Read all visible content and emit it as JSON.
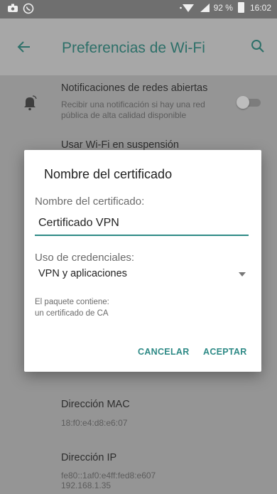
{
  "status_bar": {
    "battery": "92 %",
    "time": "16:02"
  },
  "app_bar": {
    "title": "Preferencias de Wi-Fi"
  },
  "settings": {
    "open_networks_title": "Notificaciones de redes abiertas",
    "open_networks_desc_line1": "Recibir una notificación si hay una red",
    "open_networks_desc_line2": "pública de alta calidad disponible",
    "sleep_title": "Usar Wi-Fi en suspensión",
    "mac_title": "Dirección MAC",
    "mac_value": "18:f0:e4:d8:e6:07",
    "ip_title": "Dirección IP",
    "ip_value_line1": "fe80::1af0:e4ff:fed8:e607",
    "ip_value_line2": "192.168.1.35"
  },
  "dialog": {
    "title": "Nombre del certificado",
    "name_label": "Nombre del certificado:",
    "name_value": "Certificado VPN",
    "usage_label": "Uso de credenciales:",
    "usage_value": "VPN y aplicaciones",
    "note_line1": "El paquete contiene:",
    "note_line2": "un certificado de CA",
    "cancel": "CANCELAR",
    "accept": "ACEPTAR"
  },
  "colors": {
    "accent": "#2e8a86",
    "title_teal": "#2e7069",
    "scrim": "#959595"
  }
}
